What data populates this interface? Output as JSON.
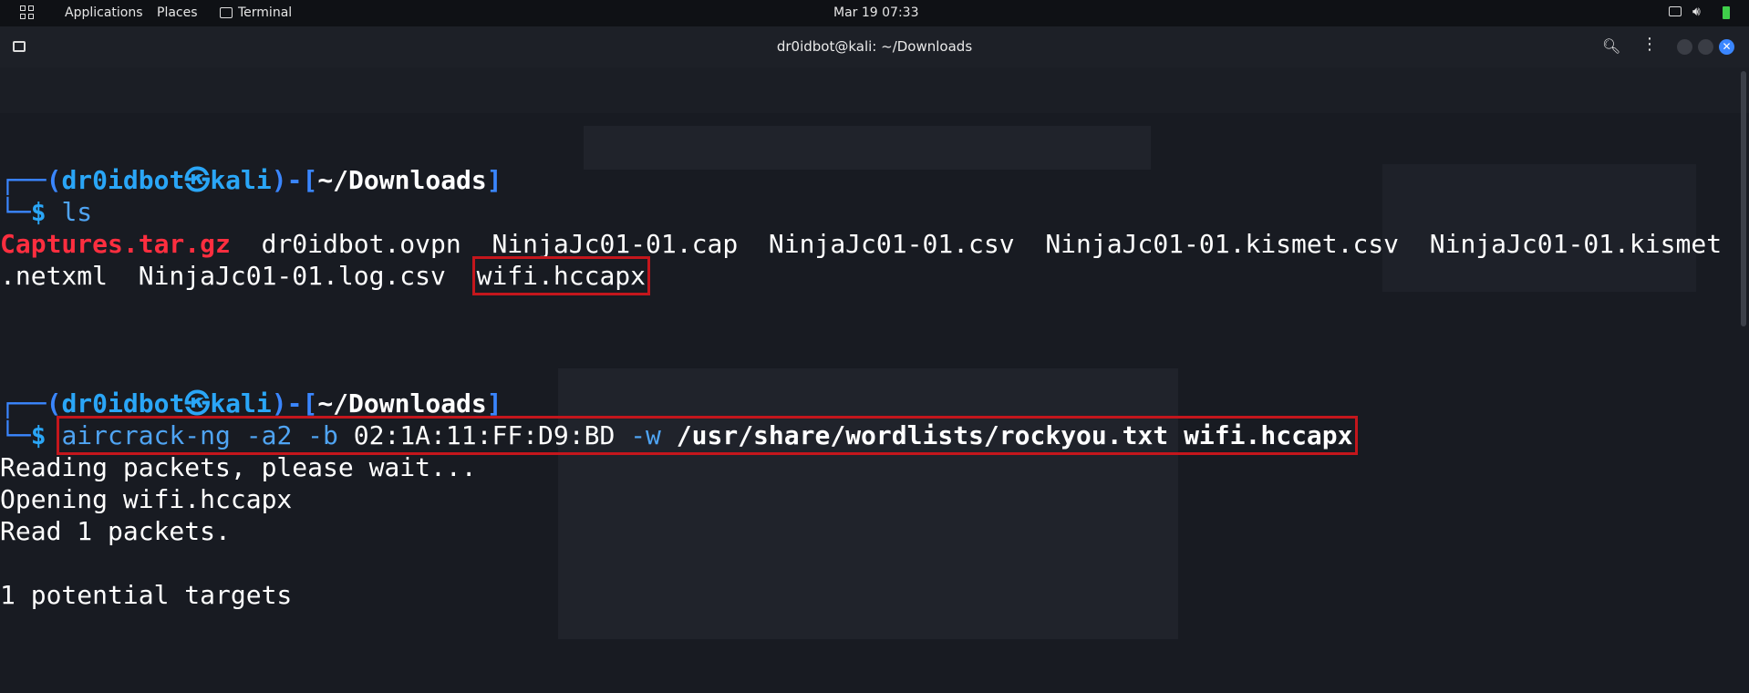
{
  "topbar": {
    "applications": "Applications",
    "places": "Places",
    "terminal": "Terminal",
    "clock": "Mar 19  07:33"
  },
  "window": {
    "title": "dr0idbot@kali: ~/Downloads"
  },
  "prompt": {
    "user": "dr0idbot",
    "host": "kali",
    "dir": "~/Downloads"
  },
  "session": {
    "cmd1": "ls",
    "ls_archive": "Captures.tar.gz",
    "ls_files_row1": "  dr0idbot.ovpn  NinjaJc01-01.cap  NinjaJc01-01.csv  NinjaJc01-01.kismet.csv  NinjaJc01-01.kismet",
    "ls_files_row2": ".netxml  NinjaJc01-01.log.csv  ",
    "ls_highlight": "wifi.hccapx",
    "cmd2_tool": "aircrack-ng",
    "cmd2_opt_a": "-a2",
    "cmd2_opt_b": "-b",
    "cmd2_bssid": "02:1A:11:FF:D9:BD",
    "cmd2_opt_w": "-w",
    "cmd2_wordlist": "/usr/share/wordlists/rockyou.txt",
    "cmd2_file": "wifi.hccapx",
    "out1": "Reading packets, please wait...",
    "out2": "Opening wifi.hccapx",
    "out3": "Read 1 packets.",
    "out4": "1 potential targets"
  },
  "colors": {
    "prompt_frame": "#3a86ff",
    "prompt_user": "#2aa6f7",
    "archive": "#ff2e3f",
    "highlight_box": "#c4161c"
  }
}
